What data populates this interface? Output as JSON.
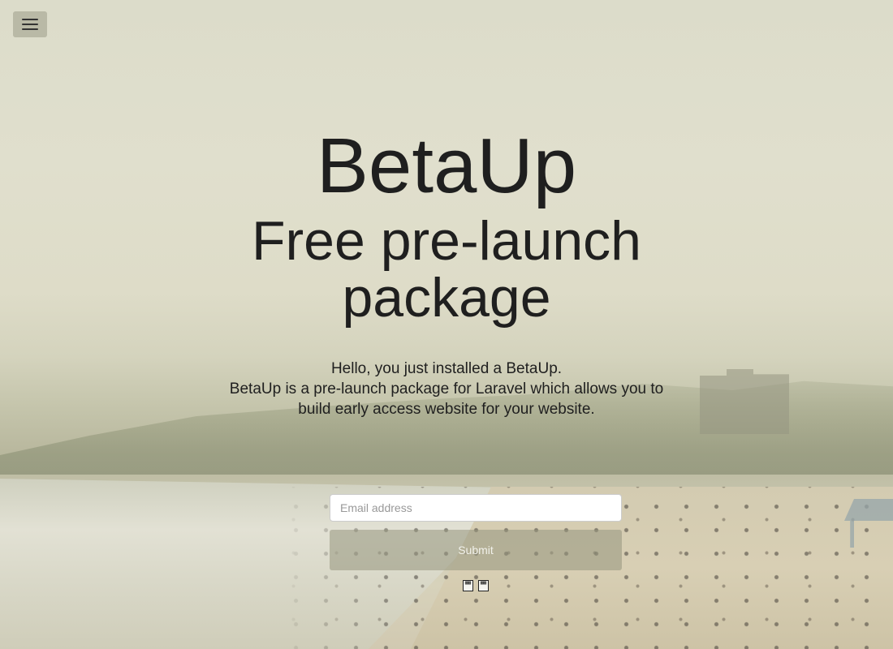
{
  "header": {
    "menu_icon": "hamburger-icon"
  },
  "hero": {
    "title": "BetaUp",
    "subtitle": "Free pre-launch package",
    "intro_line": "Hello, you just installed a BetaUp.",
    "description": "BetaUp is a pre-launch package for Laravel which allows you to build early access website for your website."
  },
  "signup": {
    "email_placeholder": "Email address",
    "email_value": "",
    "submit_label": "Submit"
  },
  "social": {
    "icons": [
      "icon-glyph-1",
      "icon-glyph-2"
    ]
  }
}
